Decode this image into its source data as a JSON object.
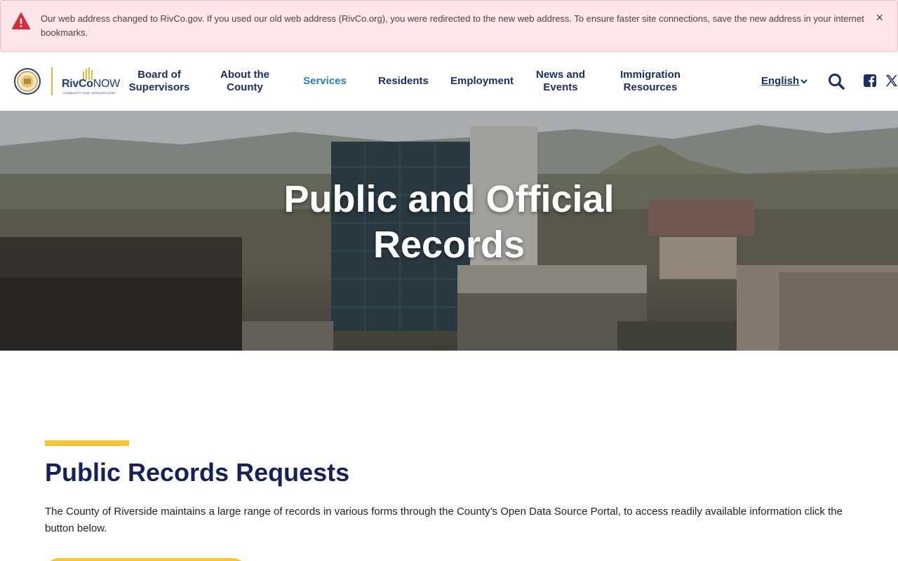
{
  "alert": {
    "message": "Our web address changed to RivCo.gov. If you used our old web address (RivCo.org), you were redirected to the new web address. To ensure faster site connections, save the new address in your internet bookmarks.",
    "close_label": "×"
  },
  "header": {
    "logo_riv": "RivCo",
    "logo_now": "NOW",
    "logo_tagline": "COMMUNITY NOW. SERVICES NOW.",
    "nav": [
      {
        "line1": "Board of",
        "line2": "Supervisors"
      },
      {
        "line1": "About the",
        "line2": "County"
      },
      {
        "label": "Services"
      },
      {
        "label": "Residents"
      },
      {
        "label": "Employment"
      },
      {
        "line1": "News and",
        "line2": "Events"
      },
      {
        "line1": "Immigration",
        "line2": "Resources"
      }
    ],
    "language": "English"
  },
  "hero": {
    "title_line1": "Public and Official",
    "title_line2": "Records"
  },
  "content": {
    "title": "Public Records Requests",
    "body": "The County of Riverside maintains a large range of records in various forms through the County’s Open Data Source Portal, to access readily available information click the button below."
  },
  "colors": {
    "navy": "#1a2e66",
    "active_link": "#2d7fb4",
    "accent_yellow": "#f7c531",
    "alert_bg": "#fde6e8",
    "alert_icon": "#d92b3a"
  }
}
